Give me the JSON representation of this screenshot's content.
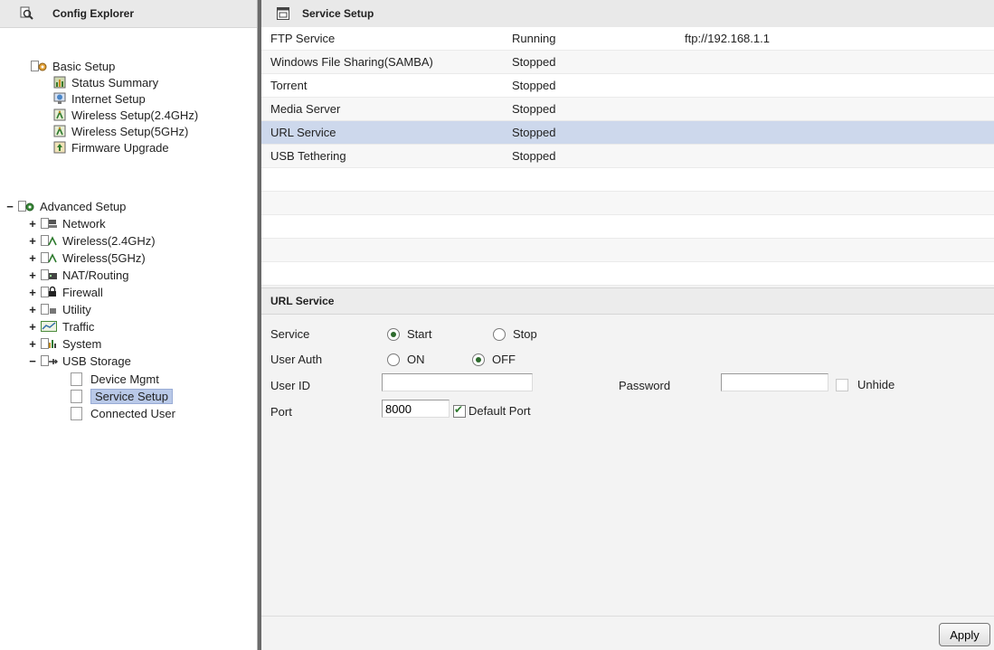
{
  "left_pane": {
    "title": "Config Explorer",
    "basic_setup": {
      "label": "Basic Setup",
      "items": [
        "Status Summary",
        "Internet Setup",
        "Wireless Setup(2.4GHz)",
        "Wireless Setup(5GHz)",
        "Firmware Upgrade"
      ]
    },
    "advanced_setup": {
      "toggle": "−",
      "label": "Advanced Setup",
      "items": [
        {
          "toggle": "+",
          "label": "Network"
        },
        {
          "toggle": "+",
          "label": "Wireless(2.4GHz)"
        },
        {
          "toggle": "+",
          "label": "Wireless(5GHz)"
        },
        {
          "toggle": "+",
          "label": "NAT/Routing"
        },
        {
          "toggle": "+",
          "label": "Firewall"
        },
        {
          "toggle": "+",
          "label": "Utility"
        },
        {
          "toggle": "+",
          "label": "Traffic"
        },
        {
          "toggle": "+",
          "label": "System"
        },
        {
          "toggle": "−",
          "label": "USB Storage"
        }
      ],
      "usb_children": [
        "Device Mgmt",
        "Service Setup",
        "Connected User"
      ],
      "selected": "Service Setup"
    }
  },
  "right_pane": {
    "title": "Service Setup",
    "services": [
      {
        "name": "FTP Service",
        "status": "Running",
        "url": "ftp://192.168.1.1"
      },
      {
        "name": "Windows File Sharing(SAMBA)",
        "status": "Stopped",
        "url": ""
      },
      {
        "name": "Torrent",
        "status": "Stopped",
        "url": ""
      },
      {
        "name": "Media Server",
        "status": "Stopped",
        "url": ""
      },
      {
        "name": "URL Service",
        "status": "Stopped",
        "url": ""
      },
      {
        "name": "USB Tethering",
        "status": "Stopped",
        "url": ""
      }
    ],
    "selected_service": "URL Service",
    "detail": {
      "title": "URL Service",
      "service_label": "Service",
      "start_label": "Start",
      "stop_label": "Stop",
      "service_value": "Start",
      "user_auth_label": "User Auth",
      "on_label": "ON",
      "off_label": "OFF",
      "user_auth_value": "OFF",
      "user_id_label": "User ID",
      "user_id_value": "",
      "password_label": "Password",
      "password_value": "",
      "unhide_label": "Unhide",
      "unhide_checked": false,
      "port_label": "Port",
      "port_value": "8000",
      "default_port_label": "Default Port",
      "default_port_checked": true
    },
    "apply_label": "Apply"
  },
  "colors": {
    "selection": "#cdd8ec",
    "header_bg": "#e9e9e9",
    "splitter": "#6a6a6a"
  }
}
